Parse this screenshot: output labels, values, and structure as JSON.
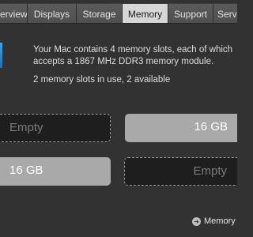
{
  "tabs": [
    {
      "label": "erview",
      "selected": false
    },
    {
      "label": "Displays",
      "selected": false
    },
    {
      "label": "Storage",
      "selected": false
    },
    {
      "label": "Memory",
      "selected": true
    },
    {
      "label": "Support",
      "selected": false
    },
    {
      "label": "Serv",
      "selected": false
    }
  ],
  "memory": {
    "description": "Your Mac contains 4 memory slots, each of which accepts a 1867 MHz DDR3 memory module.",
    "usage": "2 memory slots in use, 2 available",
    "slots": [
      {
        "label": "Empty",
        "state": "empty"
      },
      {
        "label": "16 GB",
        "state": "installed"
      },
      {
        "label": "16 GB",
        "state": "installed"
      },
      {
        "label": "Empty",
        "state": "empty"
      }
    ]
  },
  "support_link": {
    "label": "Memory",
    "icon": "arrow-circle-icon"
  },
  "colors": {
    "background": "#323232",
    "selected_tab": "#d6d6d6",
    "installed_slot": "#a9a9a9",
    "empty_slot": "#1e1e1e"
  }
}
